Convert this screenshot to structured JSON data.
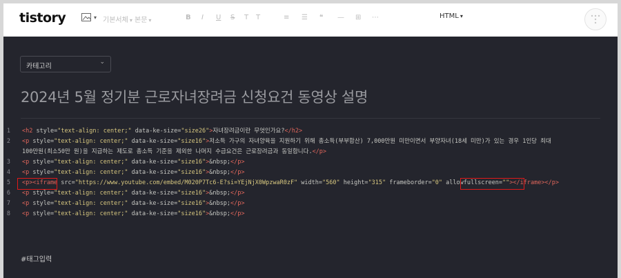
{
  "header": {
    "logo": "tistory",
    "toolbar": {
      "image_label": "",
      "normal_text": "기본서체",
      "paragraph": "본문",
      "bold": "B",
      "italic": "I",
      "underline": "U",
      "strike": "S",
      "text_color": "T",
      "bg_color": "T",
      "align": "≡",
      "list": "☰",
      "quote": "❝",
      "line": "—",
      "table": "⊞",
      "more": "⋯",
      "html_toggle": "HTML"
    }
  },
  "category": {
    "label": "카테고리"
  },
  "post_title": "2024년 5월 정기분 근로자녀장려금 신청요건 동영상 설명",
  "code_lines": [
    {
      "num": "1",
      "segments": [
        {
          "k": "t",
          "v": "<h2 "
        },
        {
          "k": "a",
          "v": "style="
        },
        {
          "k": "s",
          "v": "\"text-align: center;\""
        },
        {
          "k": "a",
          "v": " data-ke-size="
        },
        {
          "k": "s",
          "v": "\"size26\""
        },
        {
          "k": "t",
          "v": ">"
        },
        {
          "k": "p",
          "v": "자녀장려금이란 무엇인가요?"
        },
        {
          "k": "t",
          "v": "</h2>"
        }
      ]
    },
    {
      "num": "2",
      "segments": [
        {
          "k": "t",
          "v": "<p "
        },
        {
          "k": "a",
          "v": "style="
        },
        {
          "k": "s",
          "v": "\"text-align: center;\""
        },
        {
          "k": "a",
          "v": " data-ke-size="
        },
        {
          "k": "s",
          "v": "\"size16\""
        },
        {
          "k": "t",
          "v": ">"
        },
        {
          "k": "p",
          "v": "저소득 가구의 자녀양육을 지원하기 위해 총소득(부부합산) 7,000만원 미만이면서 부양자녀(18세 미만)가 있는 경우 1인당 최대"
        }
      ]
    },
    {
      "num": "",
      "segments": [
        {
          "k": "p",
          "v": "100만원(최소50만 원)을 지급하는 제도로 총소득 기준을 제외한 나머지 수급요건은 근로장려금과 동일합니다."
        },
        {
          "k": "t",
          "v": "</p>"
        }
      ]
    },
    {
      "num": "3",
      "segments": [
        {
          "k": "t",
          "v": "<p "
        },
        {
          "k": "a",
          "v": "style="
        },
        {
          "k": "s",
          "v": "\"text-align: center;\""
        },
        {
          "k": "a",
          "v": " data-ke-size="
        },
        {
          "k": "s",
          "v": "\"size16\""
        },
        {
          "k": "t",
          "v": ">"
        },
        {
          "k": "p",
          "v": "&nbsp;"
        },
        {
          "k": "t",
          "v": "</p>"
        }
      ]
    },
    {
      "num": "4",
      "segments": [
        {
          "k": "t",
          "v": "<p "
        },
        {
          "k": "a",
          "v": "style="
        },
        {
          "k": "s",
          "v": "\"text-align: center;\""
        },
        {
          "k": "a",
          "v": " data-ke-size="
        },
        {
          "k": "s",
          "v": "\"size16\""
        },
        {
          "k": "t",
          "v": ">"
        },
        {
          "k": "p",
          "v": "&nbsp;"
        },
        {
          "k": "t",
          "v": "</p>"
        }
      ]
    },
    {
      "num": "5",
      "segments": [
        {
          "k": "t",
          "v": "<p><iframe "
        },
        {
          "k": "a",
          "v": "src="
        },
        {
          "k": "s",
          "v": "\"https://www.youtube.com/embed/M020P7Tc6-E?si=YEjNjX0WpzwaR0zF\""
        },
        {
          "k": "a",
          "v": " width="
        },
        {
          "k": "s",
          "v": "\"560\""
        },
        {
          "k": "a",
          "v": " height="
        },
        {
          "k": "s",
          "v": "\"315\""
        },
        {
          "k": "a",
          "v": " frameborder="
        },
        {
          "k": "s",
          "v": "\"0\""
        },
        {
          "k": "a",
          "v": " allowfullscreen="
        },
        {
          "k": "s",
          "v": "\"\""
        },
        {
          "k": "t",
          "v": "></iframe></p>"
        }
      ]
    },
    {
      "num": "6",
      "segments": [
        {
          "k": "t",
          "v": "<p "
        },
        {
          "k": "a",
          "v": "style="
        },
        {
          "k": "s",
          "v": "\"text-align: center;\""
        },
        {
          "k": "a",
          "v": " data-ke-size="
        },
        {
          "k": "s",
          "v": "\"size16\""
        },
        {
          "k": "t",
          "v": ">"
        },
        {
          "k": "p",
          "v": "&nbsp;"
        },
        {
          "k": "t",
          "v": "</p>"
        }
      ]
    },
    {
      "num": "7",
      "segments": [
        {
          "k": "t",
          "v": "<p "
        },
        {
          "k": "a",
          "v": "style="
        },
        {
          "k": "s",
          "v": "\"text-align: center;\""
        },
        {
          "k": "a",
          "v": " data-ke-size="
        },
        {
          "k": "s",
          "v": "\"size16\""
        },
        {
          "k": "t",
          "v": ">"
        },
        {
          "k": "p",
          "v": "&nbsp;"
        },
        {
          "k": "t",
          "v": "</p>"
        }
      ]
    },
    {
      "num": "8",
      "segments": [
        {
          "k": "t",
          "v": "<p "
        },
        {
          "k": "a",
          "v": "style="
        },
        {
          "k": "s",
          "v": "\"text-align: center;\""
        },
        {
          "k": "a",
          "v": " data-ke-size="
        },
        {
          "k": "s",
          "v": "\"size16\""
        },
        {
          "k": "t",
          "v": ">"
        },
        {
          "k": "p",
          "v": "&nbsp;"
        },
        {
          "k": "t",
          "v": "</p>"
        }
      ]
    }
  ],
  "tag_input": "#태그입력",
  "colors": {
    "editor_bg": "#24252d",
    "tag": "#e0665b",
    "string": "#d7c77f",
    "highlight": "#e11a1a"
  }
}
